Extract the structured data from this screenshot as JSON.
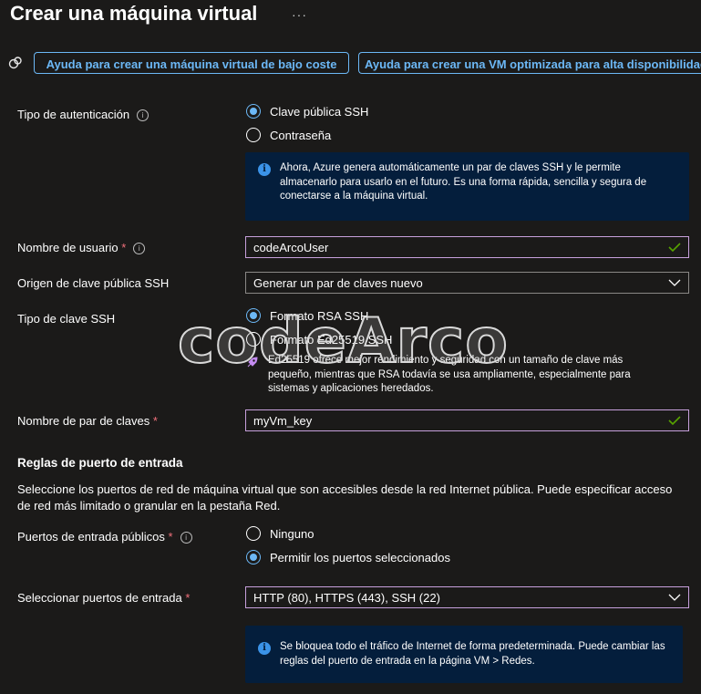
{
  "header": {
    "title": "Crear una máquina virtual",
    "more_label": "···"
  },
  "helpers": {
    "low_cost_btn": "Ayuda para crear una máquina virtual de bajo coste",
    "high_avail_btn": "Ayuda para crear una VM optimizada para alta disponibilidad"
  },
  "auth": {
    "label": "Tipo de autenticación",
    "options": [
      "Clave pública SSH",
      "Contraseña"
    ],
    "selected": "Clave pública SSH",
    "info": "Ahora, Azure genera automáticamente un par de claves SSH y le permite almacenarlo para usarlo en el futuro. Es una forma rápida, sencilla y segura de conectarse a la máquina virtual."
  },
  "username": {
    "label": "Nombre de usuario",
    "required_mark": "*",
    "value": "codeArcoUser"
  },
  "ssh_source": {
    "label": "Origen de clave pública SSH",
    "value": "Generar un par de claves nuevo"
  },
  "ssh_type": {
    "label": "Tipo de clave SSH",
    "options": [
      "Formato RSA SSH",
      "Formato Ed25519 SSH"
    ],
    "selected": "Formato RSA SSH",
    "note": "Ed25519 ofrece mejor rendimiento y seguridad con un tamaño de clave más pequeño, mientras que RSA todavía se usa ampliamente, especialmente para sistemas y aplicaciones heredados."
  },
  "keypair": {
    "label": "Nombre de par de claves",
    "required_mark": "*",
    "value": "myVm_key"
  },
  "inbound": {
    "heading": "Reglas de puerto de entrada",
    "description": "Seleccione los puertos de red de máquina virtual que son accesibles desde la red Internet pública. Puede especificar acceso de red más limitado o granular en la pestaña Red.",
    "public_ports_label": "Puertos de entrada públicos",
    "required_mark": "*",
    "port_options": [
      "Ninguno",
      "Permitir los puertos seleccionados"
    ],
    "port_selected": "Permitir los puertos seleccionados",
    "select_label": "Seleccionar puertos de entrada",
    "select_value": "HTTP (80), HTTPS (443), SSH (22)",
    "info": "Se bloquea todo el tráfico de Internet de forma predeterminada. Puede cambiar las reglas del puerto de entrada en la página VM > Redes."
  },
  "watermark": "codeArco",
  "colors": {
    "background": "#1b1a19",
    "accent": "#6cb8f6",
    "required": "#f1707b",
    "infobox": "#041e3c",
    "valid": "#57a300"
  }
}
